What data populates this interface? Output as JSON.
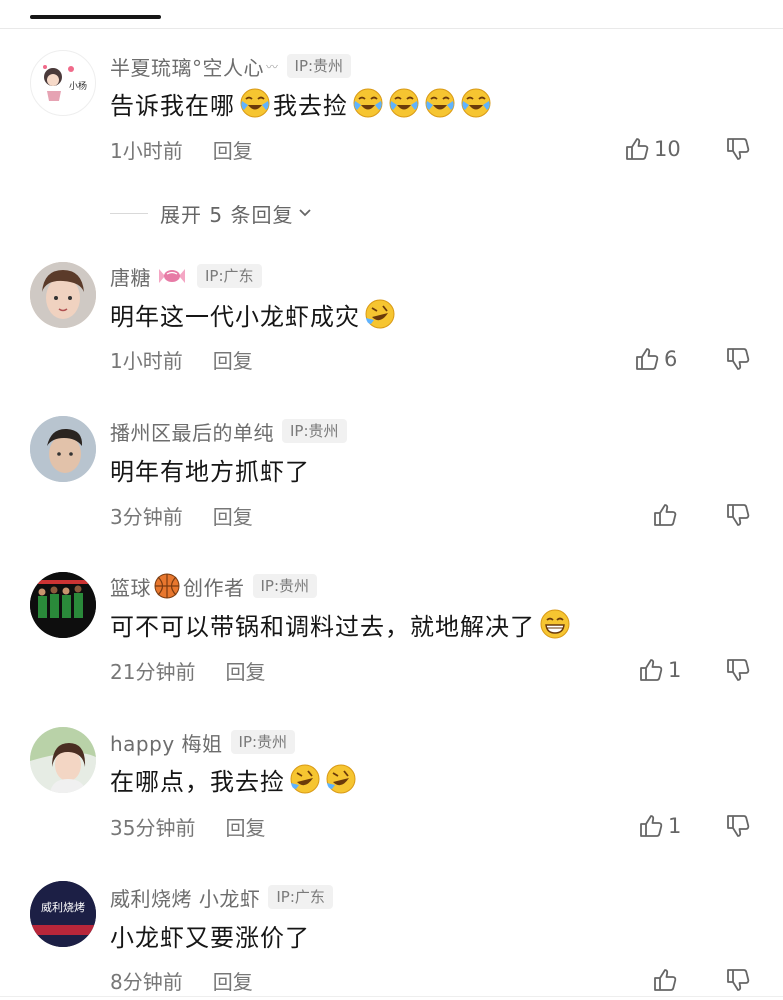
{
  "comments": [
    {
      "name": "半夏琉璃°空人心",
      "name_suffix": "〰",
      "ip": "IP:贵州",
      "text": "告诉我在哪",
      "text2": "我去捡",
      "time": "1小时前",
      "reply": "回复",
      "likes": "10"
    },
    {
      "name": "唐糖",
      "ip": "IP:广东",
      "text": "明年这一代小龙虾成灾",
      "time": "1小时前",
      "reply": "回复",
      "likes": "6"
    },
    {
      "name": "播州区最后的单纯",
      "ip": "IP:贵州",
      "text": "明年有地方抓虾了",
      "time": "3分钟前",
      "reply": "回复",
      "likes": ""
    },
    {
      "name": "篮球",
      "name2": "创作者",
      "ip": "IP:贵州",
      "text": "可不可以带锅和调料过去，就地解决了",
      "time": "21分钟前",
      "reply": "回复",
      "likes": "1"
    },
    {
      "name": "happy 梅姐",
      "ip": "IP:贵州",
      "text": "在哪点，我去捡",
      "time": "35分钟前",
      "reply": "回复",
      "likes": "1"
    },
    {
      "name": "威利烧烤 小龙虾",
      "ip": "IP:广东",
      "text": "小龙虾又要涨价了",
      "time": "8分钟前",
      "reply": "回复",
      "likes": ""
    }
  ],
  "expand_label": "展开 5 条回复",
  "avatar_texts": {
    "c1": "小杨",
    "c6": "威利烧烤"
  },
  "icons": {
    "like": "thumb-up-icon",
    "dislike": "thumb-down-icon",
    "expand": "chevron-down-icon",
    "emoji_cry": "crying-laughing-emoji-icon",
    "emoji_rofl": "rolling-laughing-emoji-icon",
    "emoji_grin": "grinning-emoji-icon",
    "basketball": "basketball-icon",
    "candy": "candy-icon"
  }
}
